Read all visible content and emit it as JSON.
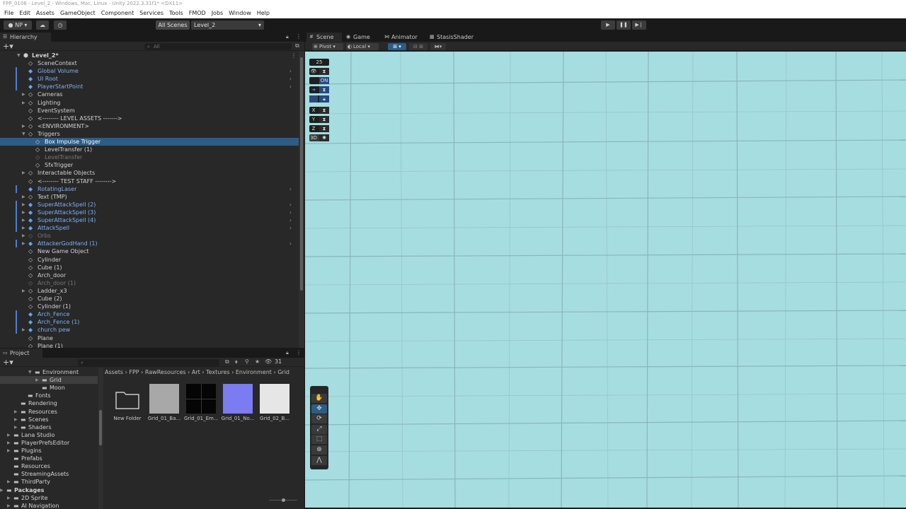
{
  "window": {
    "title": "FPP_0106 - Level_2 - Windows, Mac, Linux - Unity 2022.3.31f1* <DX11>"
  },
  "menu": [
    "File",
    "Edit",
    "Assets",
    "GameObject",
    "Component",
    "Services",
    "Tools",
    "FMOD",
    "Jobs",
    "Window",
    "Help"
  ],
  "toolbar": {
    "account_label": "NP",
    "scenes_label": "All Scenes",
    "scene_select": "Level_2",
    "play_icon": "play-icon",
    "pause_icon": "pause-icon",
    "step_icon": "step-icon"
  },
  "hierarchy": {
    "tab_label": "Hierarchy",
    "search_placeholder": "All",
    "scene_name": "Level_2*",
    "rows": [
      {
        "label": "SceneContext",
        "kind": "plain",
        "depth": 1,
        "arrow": false,
        "chevron": false,
        "bar": false
      },
      {
        "label": "Global Volume",
        "kind": "prefab",
        "depth": 1,
        "arrow": false,
        "chevron": true,
        "bar": true
      },
      {
        "label": "UI Root",
        "kind": "prefab",
        "depth": 1,
        "arrow": false,
        "chevron": true,
        "bar": true
      },
      {
        "label": "PlayerStartPoint",
        "kind": "prefab",
        "depth": 1,
        "arrow": false,
        "chevron": true,
        "bar": true
      },
      {
        "label": "Cameras",
        "kind": "plain",
        "depth": 1,
        "arrow": true,
        "chevron": false,
        "bar": false
      },
      {
        "label": "Lighting",
        "kind": "plain",
        "depth": 1,
        "arrow": true,
        "chevron": false,
        "bar": false
      },
      {
        "label": "EventSystem",
        "kind": "plain",
        "depth": 1,
        "arrow": false,
        "chevron": false,
        "bar": false
      },
      {
        "label": "<-------- LEVEL ASSETS ------->",
        "kind": "plain",
        "depth": 1,
        "arrow": false,
        "chevron": false,
        "bar": false
      },
      {
        "label": "<ENVIRONMENT>",
        "kind": "plain",
        "depth": 1,
        "arrow": true,
        "chevron": false,
        "bar": false
      },
      {
        "label": "Triggers",
        "kind": "plain",
        "depth": 1,
        "arrow": true,
        "chevron": false,
        "bar": false,
        "open": true
      },
      {
        "label": "Box Impulse Trigger",
        "kind": "selected",
        "depth": 2,
        "arrow": false,
        "chevron": false,
        "bar": false
      },
      {
        "label": "LevelTransfer (1)",
        "kind": "plain",
        "depth": 2,
        "arrow": false,
        "chevron": false,
        "bar": false
      },
      {
        "label": "LevelTransfer",
        "kind": "dimmed",
        "depth": 2,
        "arrow": false,
        "chevron": false,
        "bar": false
      },
      {
        "label": "SfxTrigger",
        "kind": "plain",
        "depth": 2,
        "arrow": false,
        "chevron": false,
        "bar": false
      },
      {
        "label": "Interactable Objects",
        "kind": "plain",
        "depth": 1,
        "arrow": true,
        "chevron": false,
        "bar": false
      },
      {
        "label": "<-------- TEST STAFF -------->",
        "kind": "plain",
        "depth": 1,
        "arrow": false,
        "chevron": false,
        "bar": false
      },
      {
        "label": "RotatingLaser",
        "kind": "prefab",
        "depth": 1,
        "arrow": false,
        "chevron": true,
        "bar": true
      },
      {
        "label": "Text (TMP)",
        "kind": "plain",
        "depth": 1,
        "arrow": true,
        "chevron": false,
        "bar": false
      },
      {
        "label": "SuperAttackSpell (2)",
        "kind": "prefab",
        "depth": 1,
        "arrow": true,
        "chevron": true,
        "bar": true
      },
      {
        "label": "SuperAttackSpell (3)",
        "kind": "prefab",
        "depth": 1,
        "arrow": true,
        "chevron": true,
        "bar": true
      },
      {
        "label": "SuperAttackSpell (4)",
        "kind": "prefab",
        "depth": 1,
        "arrow": true,
        "chevron": true,
        "bar": true
      },
      {
        "label": "AttackSpell",
        "kind": "prefab",
        "depth": 1,
        "arrow": true,
        "chevron": true,
        "bar": true
      },
      {
        "label": "Orbs",
        "kind": "dimmed",
        "depth": 1,
        "arrow": true,
        "chevron": false,
        "bar": false
      },
      {
        "label": "AttackerGodHand (1)",
        "kind": "prefab",
        "depth": 1,
        "arrow": true,
        "chevron": true,
        "bar": true
      },
      {
        "label": "New Game Object",
        "kind": "plain",
        "depth": 1,
        "arrow": false,
        "chevron": false,
        "bar": false
      },
      {
        "label": "Cylinder",
        "kind": "plain",
        "depth": 1,
        "arrow": false,
        "chevron": false,
        "bar": false
      },
      {
        "label": "Cube (1)",
        "kind": "plain",
        "depth": 1,
        "arrow": false,
        "chevron": false,
        "bar": false
      },
      {
        "label": "Arch_door",
        "kind": "plain",
        "depth": 1,
        "arrow": false,
        "chevron": false,
        "bar": false
      },
      {
        "label": "Arch_door (1)",
        "kind": "dimmed",
        "depth": 1,
        "arrow": false,
        "chevron": false,
        "bar": false
      },
      {
        "label": "Ladder_x3",
        "kind": "plain",
        "depth": 1,
        "arrow": true,
        "chevron": false,
        "bar": false
      },
      {
        "label": "Cube (2)",
        "kind": "plain",
        "depth": 1,
        "arrow": false,
        "chevron": false,
        "bar": false
      },
      {
        "label": "Cylinder (1)",
        "kind": "plain",
        "depth": 1,
        "arrow": false,
        "chevron": false,
        "bar": false
      },
      {
        "label": "Arch_Fence",
        "kind": "prefab",
        "depth": 1,
        "arrow": false,
        "chevron": false,
        "bar": true
      },
      {
        "label": "Arch_Fence (1)",
        "kind": "prefab",
        "depth": 1,
        "arrow": false,
        "chevron": false,
        "bar": true
      },
      {
        "label": "church pew",
        "kind": "prefab",
        "depth": 1,
        "arrow": true,
        "chevron": false,
        "bar": true
      },
      {
        "label": "Plane",
        "kind": "plain",
        "depth": 1,
        "arrow": false,
        "chevron": false,
        "bar": false
      },
      {
        "label": "Plane (1)",
        "kind": "plain",
        "depth": 1,
        "arrow": false,
        "chevron": false,
        "bar": false
      }
    ]
  },
  "scene_view": {
    "tabs": [
      "Scene",
      "Game",
      "Animator",
      "StasisShader"
    ],
    "pivot_label": "Pivot",
    "local_label": "Local",
    "gizmo_chips": [
      "25",
      "",
      "ON",
      "",
      "",
      "X",
      "Y",
      "Z",
      "3D"
    ],
    "tools": [
      "hand-tool-icon",
      "move-tool-icon",
      "rotate-tool-icon",
      "scale-tool-icon",
      "rect-tool-icon",
      "transform-tool-icon",
      "custom-tool-icon"
    ],
    "background": "#a6dde0"
  },
  "project": {
    "tab_label": "Project",
    "search_placeholder": "",
    "badge_count": "31",
    "breadcrumb": [
      "Assets",
      "FPP",
      "RawResources",
      "Art",
      "Textures",
      "Environment",
      "Grid"
    ],
    "tree": [
      {
        "label": "Environment",
        "indent": 3,
        "arrow": true,
        "open": true
      },
      {
        "label": "Grid",
        "indent": 4,
        "arrow": true,
        "selected": true
      },
      {
        "label": "Moon",
        "indent": 4,
        "arrow": false
      },
      {
        "label": "Fonts",
        "indent": 2,
        "arrow": false
      },
      {
        "label": "Rendering",
        "indent": 1,
        "arrow": false
      },
      {
        "label": "Resources",
        "indent": 1,
        "arrow": true
      },
      {
        "label": "Scenes",
        "indent": 1,
        "arrow": true
      },
      {
        "label": "Shaders",
        "indent": 1,
        "arrow": true
      },
      {
        "label": "Lana Studio",
        "indent": 0,
        "arrow": true
      },
      {
        "label": "PlayerPrefsEditor",
        "indent": 0,
        "arrow": true
      },
      {
        "label": "Plugins",
        "indent": 0,
        "arrow": true
      },
      {
        "label": "Prefabs",
        "indent": 0,
        "arrow": false
      },
      {
        "label": "Resources",
        "indent": 0,
        "arrow": false
      },
      {
        "label": "StreamingAssets",
        "indent": 0,
        "arrow": false
      },
      {
        "label": "ThirdParty",
        "indent": 0,
        "arrow": true
      },
      {
        "label": "Packages",
        "indent": -1,
        "arrow": true,
        "bold": true
      },
      {
        "label": "2D Sprite",
        "indent": 0,
        "arrow": true
      },
      {
        "label": "AI Navigation",
        "indent": 0,
        "arrow": true
      }
    ],
    "assets": [
      {
        "label": "New Folder",
        "preview": "folder",
        "color": "#282828"
      },
      {
        "label": "Grid_01_Ba...",
        "preview": "texture",
        "color": "#a8a8a8"
      },
      {
        "label": "Grid_01_Em...",
        "preview": "texture-grid",
        "color": "#050505"
      },
      {
        "label": "Grid_01_No...",
        "preview": "texture",
        "color": "#7b7bf2"
      },
      {
        "label": "Grid_02_B...",
        "preview": "texture",
        "color": "#e6e6e6"
      }
    ]
  }
}
